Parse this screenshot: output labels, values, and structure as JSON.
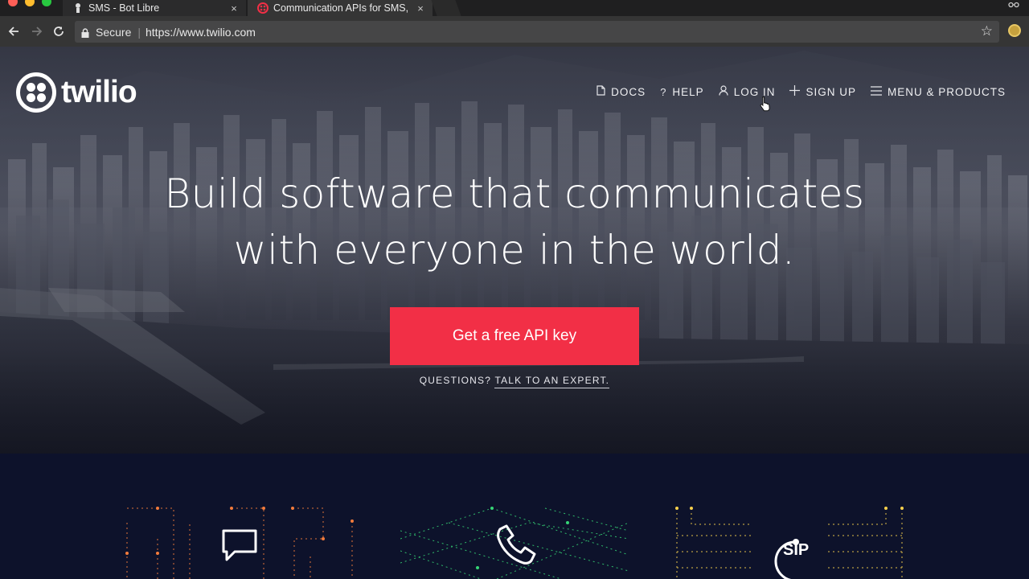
{
  "browser": {
    "tabs": [
      {
        "title": "SMS - Bot Libre",
        "close": "×"
      },
      {
        "title": "Communication APIs for SMS, ",
        "close": "×"
      }
    ],
    "secure_label": "Secure",
    "url": "https://www.twilio.com"
  },
  "site": {
    "logo_text": "twilio",
    "nav": [
      {
        "label": "DOCS",
        "icon": "document-icon"
      },
      {
        "label": "HELP",
        "icon": "question-icon"
      },
      {
        "label": "LOG IN",
        "icon": "user-icon"
      },
      {
        "label": "SIGN UP",
        "icon": "plus-icon"
      },
      {
        "label": "MENU & PRODUCTS",
        "icon": "hamburger-icon"
      }
    ],
    "headline_line1": "Build software that communicates",
    "headline_line2": "with everyone in the world.",
    "cta_label": "Get a free API key",
    "questions_prefix": "QUESTIONS?",
    "questions_link": "TALK TO AN EXPERT.",
    "products": [
      {
        "icon": "message-icon",
        "circuit_color": "#f47c3c"
      },
      {
        "icon": "phone-icon",
        "circuit_color": "#36d576"
      },
      {
        "icon": "sip-icon",
        "label": "SIP",
        "circuit_color": "#f8d04c"
      }
    ]
  },
  "colors": {
    "cta": "#f22f46",
    "lower_bg": "#0d122b",
    "tab_bar": "#1f1f20",
    "toolbar": "#353535"
  }
}
